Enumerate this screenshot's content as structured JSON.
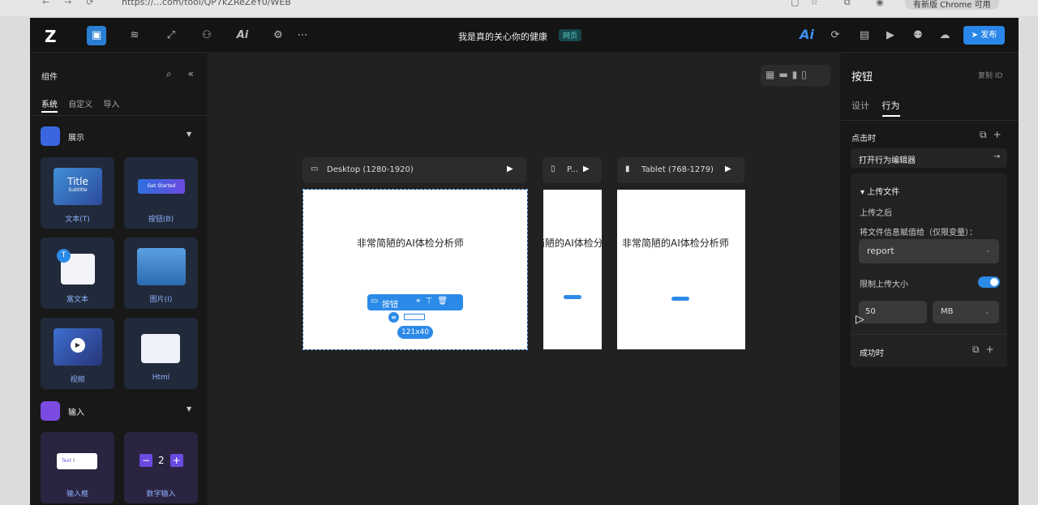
{
  "browser": {
    "url": "https://...com/tool/QP7kZReZeY0/WEB",
    "update_label": "有新版 Chrome 可用"
  },
  "topbar": {
    "logo": "Z",
    "page_title": "我是真的关心你的健康",
    "page_badge": "网页",
    "ai_label": "Ai",
    "publish_label": "发布",
    "tool_ai_label": "Ai"
  },
  "left_panel": {
    "title": "组件",
    "tabs": [
      "系统",
      "自定义",
      "导入"
    ],
    "sections": [
      {
        "label": "展示",
        "items": [
          "文本(T)",
          "按钮(B)",
          "富文本",
          "图片(I)",
          "视频",
          "Html"
        ]
      },
      {
        "label": "输入",
        "items": [
          "输入框",
          "数字输入"
        ]
      }
    ],
    "thumb_title": "Title",
    "thumb_subtitle": "Subtitle",
    "thumb_button": "Get Started",
    "thumb_text": "Text",
    "thumb_number": "2"
  },
  "canvas": {
    "frames": [
      {
        "label": "Desktop (1280-1920)",
        "text": "非常简陋的AI体检分析师"
      },
      {
        "label": "P...",
        "text": "非常简陋的AI体检分析师"
      },
      {
        "label": "Tablet (768-1279)",
        "text": "非常简陋的AI体检分析师"
      }
    ],
    "selection_toolbar_label": "按钮",
    "size_label": "121x40"
  },
  "right_panel": {
    "title": "按钮",
    "copy_id": "复制 ID",
    "tabs": [
      "设计",
      "行为"
    ],
    "on_click": "点击时",
    "open_editor": "打开行为编辑器",
    "upload_section": "上传文件",
    "after_upload": "上传之后",
    "assign_label": "将文件信息赋值给（仅限变量）：",
    "variable_value": "report",
    "limit_label": "限制上传大小",
    "limit_enabled": true,
    "size_value": "50",
    "size_unit": "MB",
    "on_success": "成功时"
  },
  "colors": {
    "accent": "#2b8ae8",
    "bg": "#1b1b1b"
  }
}
